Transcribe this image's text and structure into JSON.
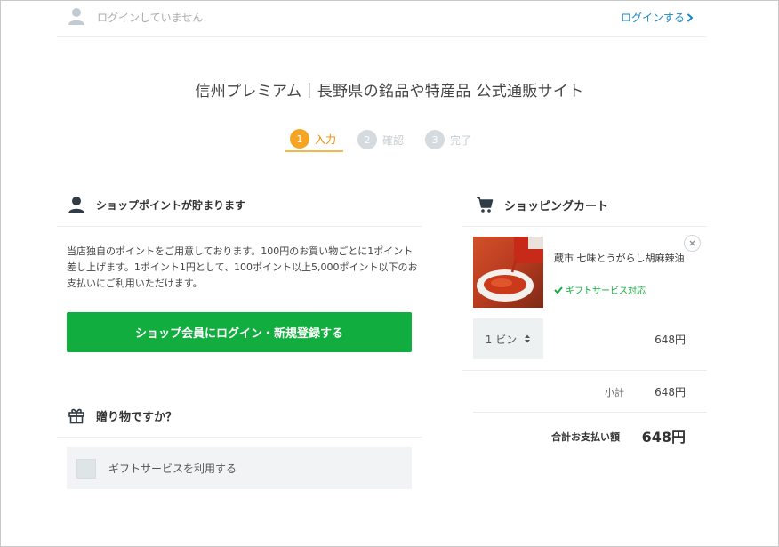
{
  "header": {
    "login_status": "ログインしていません",
    "login_link": "ログインする"
  },
  "page_title": "信州プレミアム｜長野県の銘品や特産品 公式通販サイト",
  "steps": [
    {
      "num": "1",
      "label": "入力",
      "state": "active"
    },
    {
      "num": "2",
      "label": "確認",
      "state": "inactive"
    },
    {
      "num": "3",
      "label": "完了",
      "state": "inactive"
    }
  ],
  "points": {
    "heading": "ショップポイントが貯まります",
    "description": "当店独自のポイントをご用意しております。100円のお買い物ごとに1ポイント差し上げます。1ポイント1円として、100ポイント以上5,000ポイント以下のお支払いにご利用いただけます。",
    "button_label": "ショップ会員にログイン・新規登録する"
  },
  "gift": {
    "heading": "贈り物ですか？",
    "option_label": "ギフトサービスを利用する"
  },
  "cart": {
    "heading": "ショッピングカート",
    "item": {
      "name": "蔵市 七味とうがらし胡麻辣油",
      "gift_note": "ギフトサービス対応",
      "quantity": "1 ビン",
      "price": "648円"
    },
    "subtotal_label": "小計",
    "subtotal_value": "648円",
    "total_label": "合計お支払い額",
    "total_value": "648円"
  },
  "colors": {
    "accent_green": "#12ad3f",
    "step_active": "#f5a523",
    "link_blue": "#1a86c7"
  }
}
